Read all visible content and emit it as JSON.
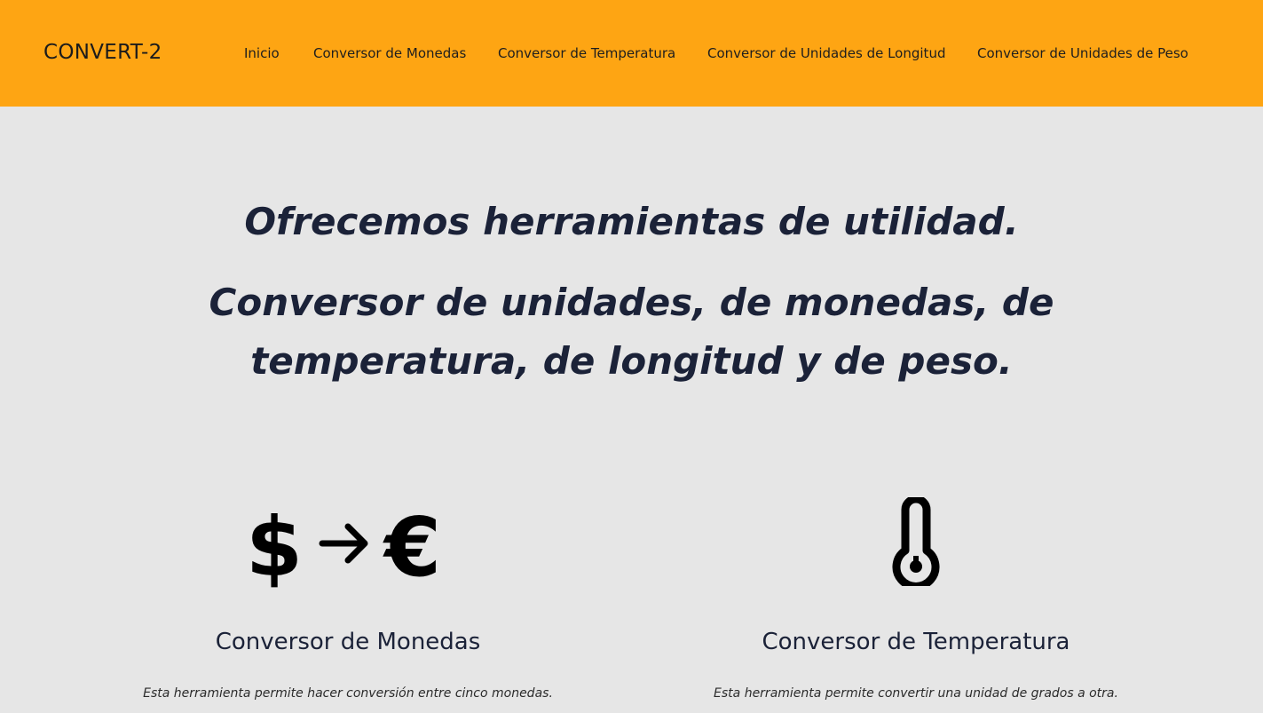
{
  "navbar": {
    "brand": "CONVERT-2",
    "background": "#fea513",
    "links": [
      "Inicio",
      "Conversor de Monedas",
      "Conversor de Temperatura",
      "Conversor de Unidades de Longitud",
      "Conversor de Unidades de Peso"
    ]
  },
  "hero": {
    "line1": "Ofrecemos herramientas de utilidad.",
    "line2": "Conversor de unidades, de monedas, de temperatura, de longitud y de peso."
  },
  "cards": [
    {
      "icon": "dollar-to-euro-icon",
      "title": "Conversor de Monedas",
      "text": "Esta herramienta permite hacer conversión entre cinco monedas."
    },
    {
      "icon": "thermometer-icon",
      "title": "Conversor de Temperatura",
      "text": "Esta herramienta permite convertir una unidad de grados a otra."
    }
  ]
}
